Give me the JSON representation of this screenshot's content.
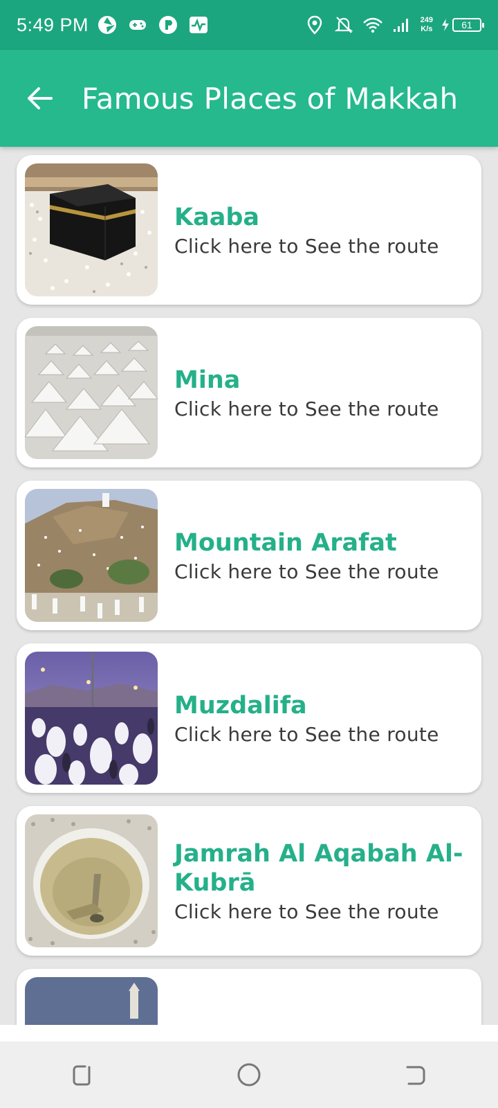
{
  "status_bar": {
    "time": "5:49 PM",
    "speed_value": "249",
    "speed_unit": "K/s",
    "battery": "61"
  },
  "app_bar": {
    "title": "Famous Places of Makkah"
  },
  "places": [
    {
      "name": "Kaaba",
      "subtitle": "Click here to See the route"
    },
    {
      "name": "Mina",
      "subtitle": "Click here to See the route"
    },
    {
      "name": "Mountain Arafat",
      "subtitle": "Click here to See the route"
    },
    {
      "name": "Muzdalifa",
      "subtitle": "Click here to See the route"
    },
    {
      "name": "Jamrah Al Aqabah Al-Kubrā",
      "subtitle": "Click here to See the route"
    }
  ],
  "colors": {
    "status_bar": "#1ba67f",
    "app_bar": "#25b98d",
    "accent_text": "#25b08a"
  }
}
